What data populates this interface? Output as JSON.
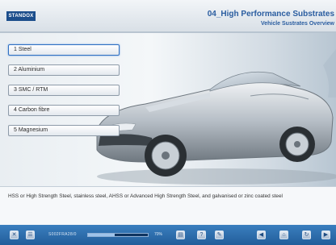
{
  "header": {
    "logo": "STANDOX",
    "title": "04_High Performance Substrates",
    "subtitle": "Vehicle Sustrates Overview"
  },
  "menu": {
    "items": [
      {
        "label": "1  Steel",
        "active": true
      },
      {
        "label": "2  Aluminium",
        "active": false
      },
      {
        "label": "3  SMC / RTM",
        "active": false
      },
      {
        "label": "4  Carbon fibre",
        "active": false
      },
      {
        "label": "5  Magnesium",
        "active": false
      }
    ]
  },
  "description": {
    "text": "HSS or High Strength Steel, stainless steel, AHSS or Advanced High Strength Steel, and galvanised or zinc coated steel"
  },
  "toolbar": {
    "code": "S002FRA28/0",
    "progress": 0.45,
    "percent": "70%"
  },
  "colors": {
    "brand": "#1c4e8c",
    "title": "#2a5da0",
    "toolbar": "#2c6aa8",
    "active_border": "#2e6fc2"
  }
}
